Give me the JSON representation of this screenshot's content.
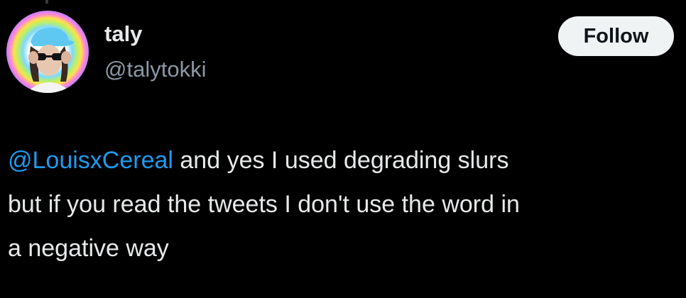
{
  "author": {
    "name": "taly",
    "handle": "@talytokki"
  },
  "follow_button": {
    "label": "Follow"
  },
  "tweet": {
    "mention": "@LouisxCereal",
    "line1_rest": " and yes I used degrading slurs",
    "line2": "but if you read the tweets I don't use the word in",
    "line3": "a negative way"
  },
  "colors": {
    "background": "#000000",
    "text": "#e7e9ea",
    "secondary_text": "#8b98a5",
    "mention": "#1d9bf0",
    "follow_button_bg": "#eff3f4",
    "follow_button_text": "#0f1419"
  },
  "icons": {
    "avatar": "profile-photo"
  }
}
